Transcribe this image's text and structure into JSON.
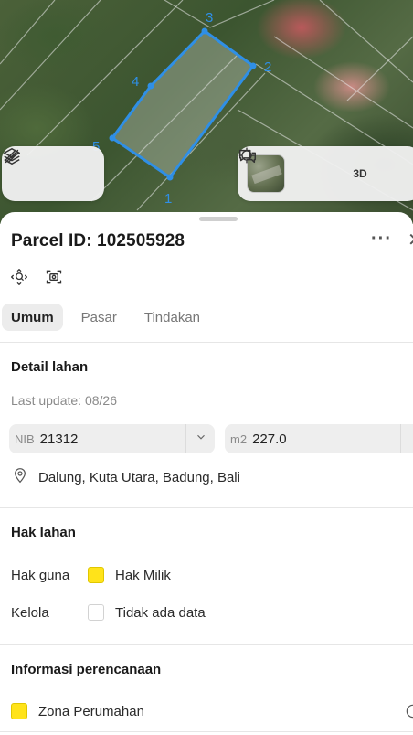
{
  "map": {
    "parcel_vertices": [
      "1",
      "2",
      "3",
      "4",
      "5"
    ],
    "layers_icon": "layers-icon",
    "measure_icon": "ruler-icon",
    "locate_icon": "crosshair-icon",
    "threed_label": "3D",
    "feedback_icon": "chat-icon",
    "accent_color": "#2f8fe6"
  },
  "header": {
    "title": "Parcel ID: 102505928",
    "more_label": "···",
    "close_label": "✕"
  },
  "tabs": [
    {
      "label": "Umum",
      "active": true
    },
    {
      "label": "Pasar",
      "active": false
    },
    {
      "label": "Tindakan",
      "active": false
    }
  ],
  "detail": {
    "title": "Detail lahan",
    "last_update": "Last update: 08/26",
    "nib_prefix": "NIB",
    "nib_value": "21312",
    "area_prefix": "m2",
    "area_value": "227.0",
    "address": "Dalung, Kuta Utara, Badung, Bali"
  },
  "rights": {
    "title": "Hak lahan",
    "rows": [
      {
        "label": "Hak guna",
        "value": "Hak Milik",
        "color": "#ffe31a"
      },
      {
        "label": "Kelola",
        "value": "Tidak ada data",
        "color": "#ffffff"
      }
    ]
  },
  "planning": {
    "title": "Informasi perencanaan",
    "zone": "Zona Perumahan",
    "zone_color": "#ffe31a"
  }
}
